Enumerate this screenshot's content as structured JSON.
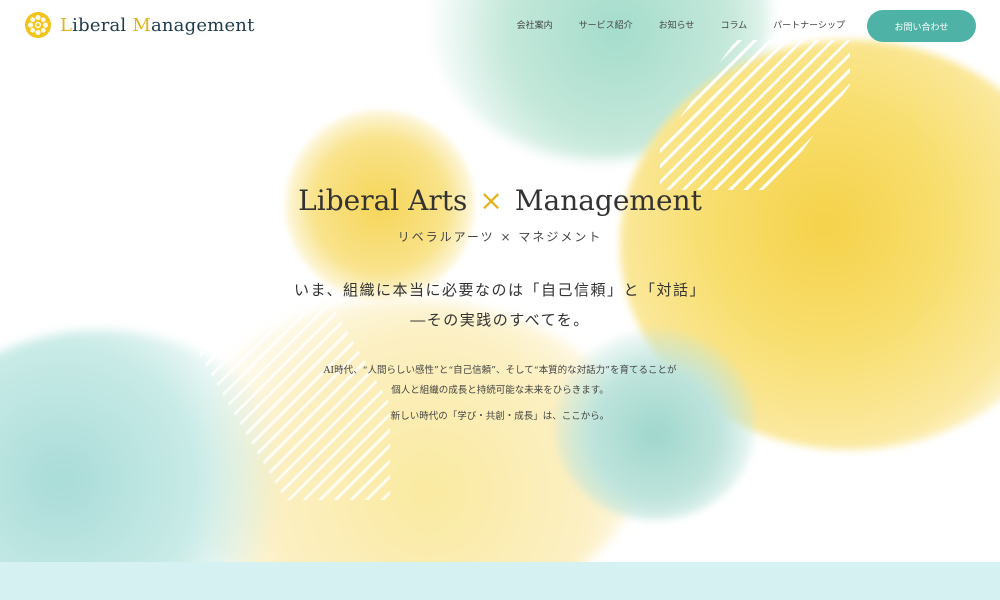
{
  "brand": {
    "logo_text_first_initial": "L",
    "logo_text_first_rest": "iberal ",
    "logo_text_second_initial": "M",
    "logo_text_second_rest": "anagement",
    "logo_icon": "flower-emblem-icon",
    "accent_color": "#e3b21c",
    "primary_color": "#1f3a4a"
  },
  "nav": {
    "items": [
      {
        "label": "会社案内"
      },
      {
        "label": "サービス紹介"
      },
      {
        "label": "お知らせ"
      },
      {
        "label": "コラム"
      },
      {
        "label": "パートナーシップ"
      }
    ],
    "contact_label": "お問い合わせ",
    "contact_color": "#4fb2a6"
  },
  "hero": {
    "title_left": "Liberal Arts",
    "title_times": "×",
    "title_right": "Management",
    "subtitle": "リベラルアーツ × マネジメント",
    "tagline_line1": "いま、組織に本当に必要なのは「自己信頼」と「対話」",
    "tagline_line2": "―その実践のすべてを。",
    "body_line1": "AI時代、“人間らしい感性”と“自己信頼”、そして“本質的な対話力”を育てることが",
    "body_line2": "個人と組織の成長と持続可能な未来をひらきます。",
    "body_line3": "新しい時代の「学び・共創・成長」は、ここから。"
  },
  "colors": {
    "yellow": "#f5d24a",
    "teal": "#a4dccb",
    "bottom_strip": "#d5f1f1"
  }
}
